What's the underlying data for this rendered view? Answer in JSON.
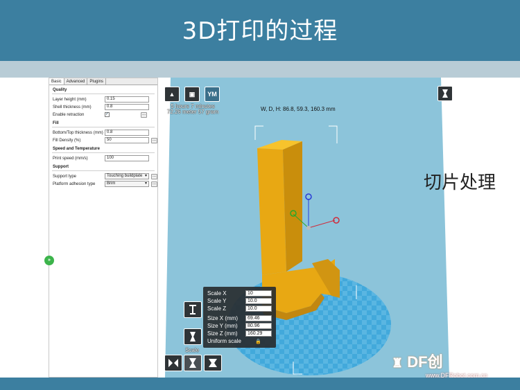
{
  "slide": {
    "title": "3D打印的过程",
    "side_text": "切片处理",
    "logo_text": "DF创",
    "logo_url": "www.DFRobot.com.cn"
  },
  "settings": {
    "tabs": [
      "Basic",
      "Advanced",
      "Plugins"
    ],
    "sections": {
      "quality": {
        "title": "Quality",
        "layer_height_label": "Layer height (mm)",
        "layer_height_value": "0.15",
        "shell_thickness_label": "Shell thickness (mm)",
        "shell_thickness_value": "0.8",
        "retraction_label": "Enable retraction",
        "retraction_checked": "✓"
      },
      "fill": {
        "title": "Fill",
        "bottom_top_label": "Bottom/Top thickness (mm)",
        "bottom_top_value": "0.8",
        "density_label": "Fill Density (%)",
        "density_value": "50"
      },
      "speed": {
        "title": "Speed and Temperature",
        "print_speed_label": "Print speed (mm/s)",
        "print_speed_value": "100"
      },
      "support": {
        "title": "Support",
        "support_type_label": "Support type",
        "support_type_value": "Touching buildplate",
        "adhesion_label": "Platform adhesion type",
        "adhesion_value": "Brim"
      }
    },
    "more_button": "..."
  },
  "viewport": {
    "toolbar": {
      "load_icon": "load-icon",
      "save_icon": "save-icon",
      "ym_label": "YM"
    },
    "print_info_line1": "5 hours 7 minutes",
    "print_info_line2": "72.26 meter 57 gram",
    "dimensions": "W, D, H: 86.8, 59.3, 160.3 mm",
    "scale_panel": {
      "scale_x_label": "Scale X",
      "scale_x_value": "10",
      "scale_y_label": "Scale Y",
      "scale_y_value": "10.0",
      "scale_z_label": "Scale Z",
      "scale_z_value": "10.0",
      "size_x_label": "Size X (mm)",
      "size_x_value": "69.46",
      "size_y_label": "Size Y (mm)",
      "size_y_value": "80.96",
      "size_z_label": "Size Z (mm)",
      "size_z_value": "160.29",
      "uniform_label": "Uniform scale",
      "lock_icon": "lock-icon"
    },
    "scale_label": "Scale",
    "colors": {
      "beam": "#8cc4da",
      "bed": "#3aa6d9",
      "model": "#f0b21a"
    }
  }
}
